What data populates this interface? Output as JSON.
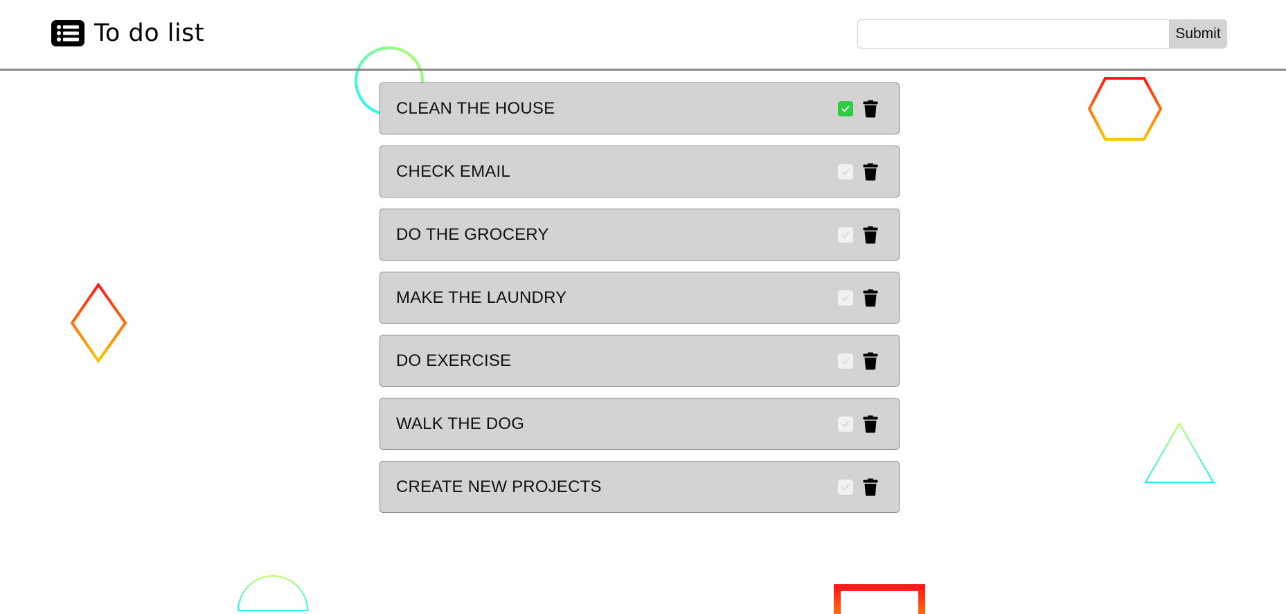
{
  "header": {
    "title": "To do list",
    "logo_icon": "list-icon",
    "search": {
      "value": "",
      "placeholder": ""
    },
    "submit_label": "Submit"
  },
  "todos": [
    {
      "text": "CLEAN THE HOUSE",
      "done": true
    },
    {
      "text": "CHECK EMAIL",
      "done": false
    },
    {
      "text": "DO THE GROCERY",
      "done": false
    },
    {
      "text": "MAKE THE LAUNDRY",
      "done": false
    },
    {
      "text": "DO EXERCISE",
      "done": false
    },
    {
      "text": "WALK THE DOG",
      "done": false
    },
    {
      "text": "CREATE NEW PROJECTS",
      "done": false
    }
  ],
  "icons": {
    "check": "check-icon",
    "delete": "trash-icon"
  },
  "colors": {
    "done_check": "#2ecc40",
    "item_bg": "#d3d3d3",
    "warm_gradient": [
      "#ff1a1a",
      "#ffc400"
    ],
    "cool_gradient": [
      "#b6ff5c",
      "#19f4ff"
    ]
  }
}
